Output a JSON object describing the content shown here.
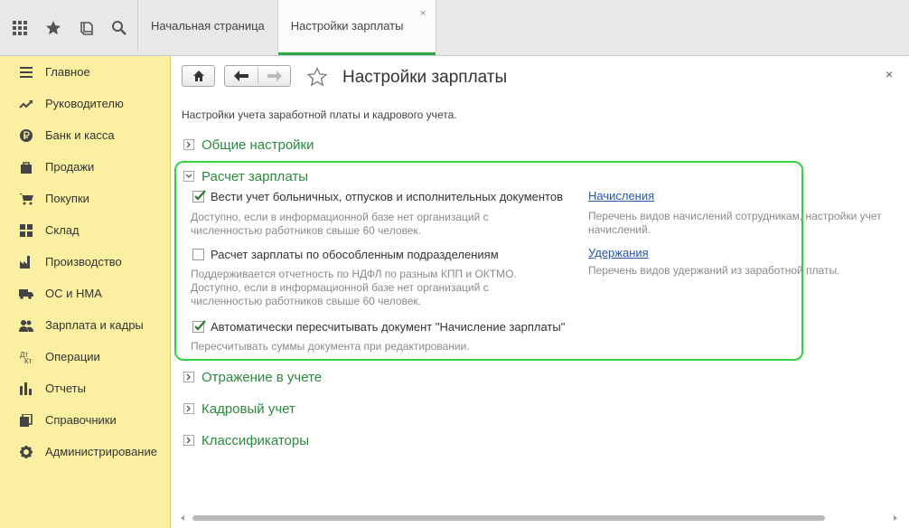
{
  "colors": {
    "accent_green": "#2ea94a",
    "sidebar_bg": "#fbf0a2",
    "link": "#2a57a8",
    "highlight_frame": "#34d23c"
  },
  "toolbar": {
    "icons": [
      "apps-grid-icon",
      "star-icon",
      "history-icon",
      "search-icon"
    ]
  },
  "tabs": [
    {
      "label": "Начальная страница",
      "active": false
    },
    {
      "label": "Настройки зарплаты",
      "active": true,
      "close": "×"
    }
  ],
  "sidebar": {
    "items": [
      {
        "label": "Главное",
        "icon": "menu-lines-icon"
      },
      {
        "label": "Руководителю",
        "icon": "trend-icon"
      },
      {
        "label": "Банк и касса",
        "icon": "ruble-coin-icon"
      },
      {
        "label": "Продажи",
        "icon": "shopping-bag-icon"
      },
      {
        "label": "Покупки",
        "icon": "cart-icon"
      },
      {
        "label": "Склад",
        "icon": "warehouse-icon"
      },
      {
        "label": "Производство",
        "icon": "factory-icon"
      },
      {
        "label": "ОС и НМА",
        "icon": "truck-icon"
      },
      {
        "label": "Зарплата и кадры",
        "icon": "people-icon"
      },
      {
        "label": "Операции",
        "icon": "operations-icon"
      },
      {
        "label": "Отчеты",
        "icon": "bar-chart-icon"
      },
      {
        "label": "Справочники",
        "icon": "books-icon"
      },
      {
        "label": "Администрирование",
        "icon": "gear-icon"
      }
    ]
  },
  "page": {
    "title": "Настройки зарплаты",
    "close": "×",
    "description": "Настройки учета заработной платы и кадрового учета."
  },
  "groups": {
    "general": {
      "label": "Общие настройки",
      "expanded": false
    },
    "payroll": {
      "label": "Расчет зарплаты",
      "expanded": true
    },
    "accounting": {
      "label": "Отражение в учете",
      "expanded": false
    },
    "hr": {
      "label": "Кадровый учет",
      "expanded": false
    },
    "classifiers": {
      "label": "Классификаторы",
      "expanded": false
    }
  },
  "payroll": {
    "options": [
      {
        "label": "Вести учет больничных, отпусков и исполнительных документов",
        "checked": true,
        "hint": [
          "Доступно, если в информационной базе нет организаций с",
          "численностью работников свыше 60 человек."
        ]
      },
      {
        "label": "Расчет зарплаты по обособленным подразделениям",
        "checked": false,
        "hint": [
          "Поддерживается отчетность по НДФЛ по разным КПП и ОКТМО.",
          "Доступно, если в информационной базе нет организаций с",
          "численностью работников свыше 60 человек."
        ]
      },
      {
        "label": "Автоматически пересчитывать документ \"Начисление зарплаты\"",
        "checked": true,
        "hint": [
          "Пересчитывать суммы документа при редактировании."
        ]
      }
    ],
    "links": [
      {
        "label": "Начисления",
        "hint": [
          "Перечень видов начислений сотрудникам, настройки учет",
          "начислений."
        ]
      },
      {
        "label": "Удержания",
        "hint": [
          "Перечень видов удержаний из заработной платы."
        ]
      }
    ]
  }
}
